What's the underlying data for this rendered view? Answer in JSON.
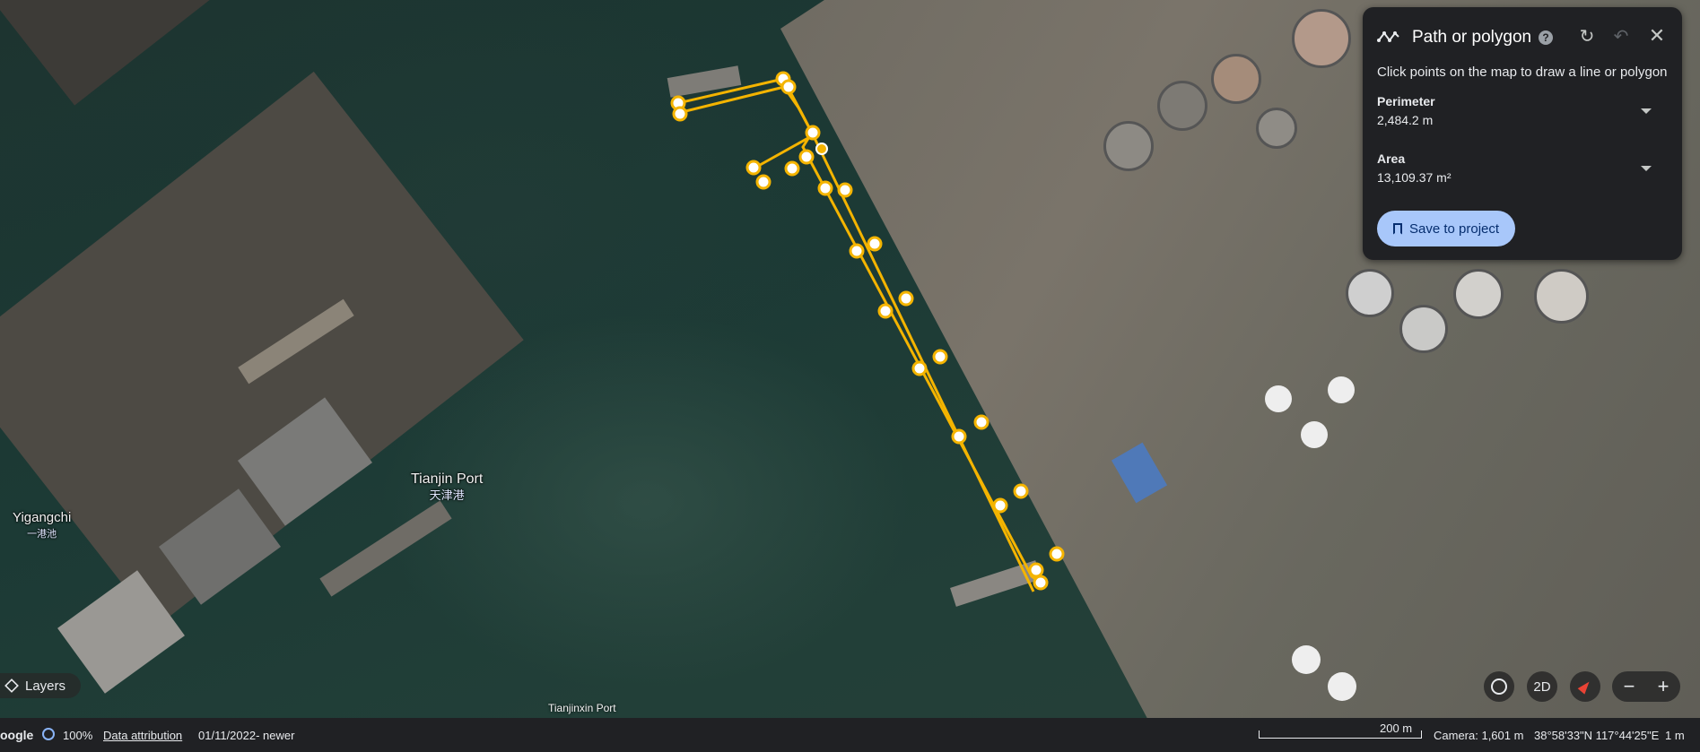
{
  "panel": {
    "title": "Path or polygon",
    "hint": "Click points on the map to draw a line or polygon",
    "perimeter_label": "Perimeter",
    "perimeter_value": "2,484.2 m",
    "area_label": "Area",
    "area_value": "13,109.37 m²",
    "save_label": "Save to project",
    "icons": [
      "path-icon",
      "help-icon",
      "redo-icon",
      "undo-icon",
      "close-icon",
      "bookmark-icon"
    ]
  },
  "map": {
    "labels": {
      "tianjin_port": "Tianjin Port",
      "tianjin_port_cn": "天津港",
      "yigangchi": "Yigangchi",
      "yigangchi_cn": "一港池",
      "tianjinxin_port": "Tianjinxin Port"
    },
    "layers_label": "Layers",
    "mode_label": "2D",
    "colors": {
      "path": "#f4b400",
      "panel": "#202124",
      "button": "#a8c7fa"
    }
  },
  "footer": {
    "brand": "oogle",
    "percent": "100%",
    "attribution": "Data attribution",
    "date": "01/11/2022- newer",
    "scale": "200 m",
    "camera": "Camera: 1,601 m",
    "coords": "38°58'33\"N 117°44'25\"E",
    "scale_small": "1 m"
  }
}
